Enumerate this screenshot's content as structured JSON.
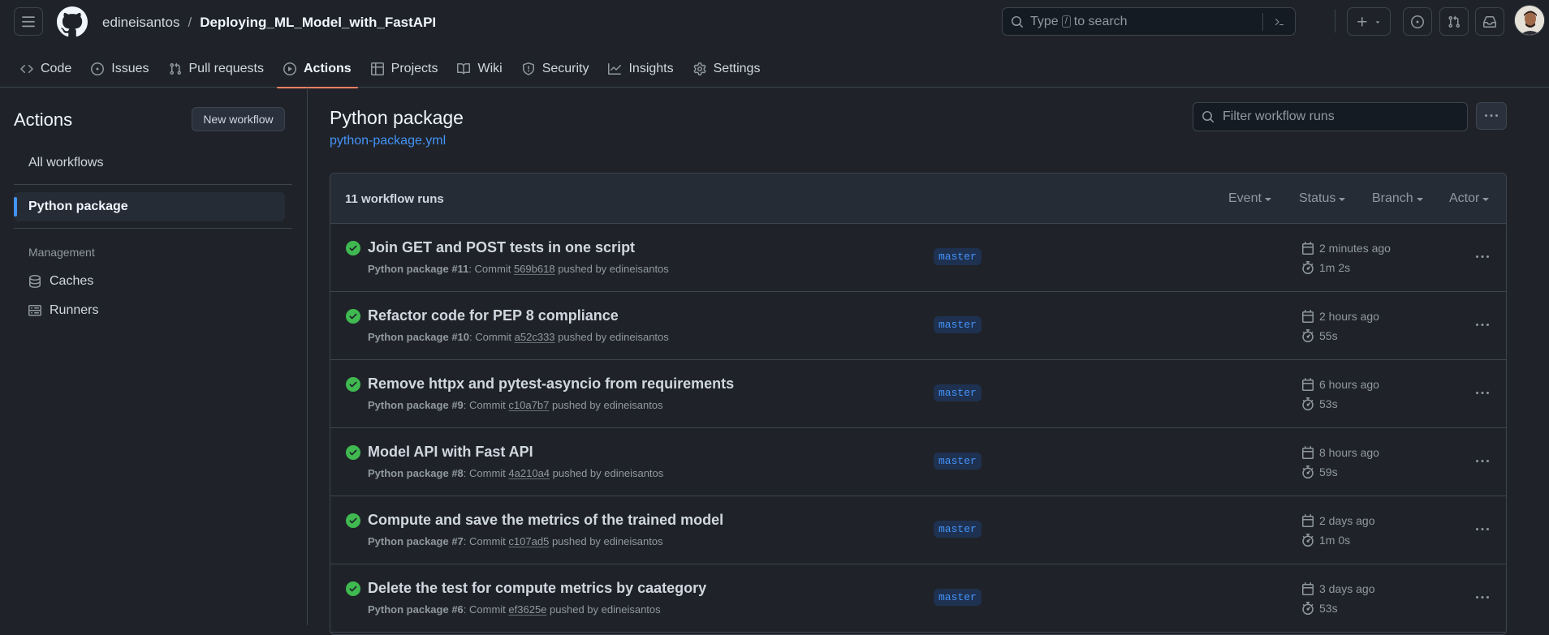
{
  "header": {
    "owner": "edineisantos",
    "separator": "/",
    "repo": "Deploying_ML_Model_with_FastAPI",
    "search_prefix": "Type",
    "search_key": "/",
    "search_suffix": "to search"
  },
  "tabs": [
    {
      "label": "Code",
      "icon": "code-icon"
    },
    {
      "label": "Issues",
      "icon": "issue-opened-icon"
    },
    {
      "label": "Pull requests",
      "icon": "git-pull-request-icon"
    },
    {
      "label": "Actions",
      "icon": "play-icon",
      "active": true
    },
    {
      "label": "Projects",
      "icon": "table-icon"
    },
    {
      "label": "Wiki",
      "icon": "book-icon"
    },
    {
      "label": "Security",
      "icon": "shield-icon"
    },
    {
      "label": "Insights",
      "icon": "graph-icon"
    },
    {
      "label": "Settings",
      "icon": "gear-icon"
    }
  ],
  "sidebar": {
    "title": "Actions",
    "new_workflow": "New workflow",
    "all_workflows": "All workflows",
    "selected_workflow": "Python package",
    "management_heading": "Management",
    "caches": "Caches",
    "runners": "Runners"
  },
  "main": {
    "title": "Python package",
    "workflow_file": "python-package.yml",
    "filter_placeholder": "Filter workflow runs",
    "runs_count": "11 workflow runs",
    "filters": [
      "Event",
      "Status",
      "Branch",
      "Actor"
    ]
  },
  "runs": [
    {
      "title": "Join GET and POST tests in one script",
      "workflow": "Python package",
      "number": "#11",
      "commit_label": ": Commit",
      "sha": "569b618",
      "pushed_by": "pushed by edineisantos",
      "branch": "master",
      "when": "2 minutes ago",
      "duration": "1m 2s",
      "status": "success"
    },
    {
      "title": "Refactor code for PEP 8 compliance",
      "workflow": "Python package",
      "number": "#10",
      "commit_label": ": Commit",
      "sha": "a52c333",
      "pushed_by": "pushed by edineisantos",
      "branch": "master",
      "when": "2 hours ago",
      "duration": "55s",
      "status": "success"
    },
    {
      "title": "Remove httpx and pytest-asyncio from requirements",
      "workflow": "Python package",
      "number": "#9",
      "commit_label": ": Commit",
      "sha": "c10a7b7",
      "pushed_by": "pushed by edineisantos",
      "branch": "master",
      "when": "6 hours ago",
      "duration": "53s",
      "status": "success"
    },
    {
      "title": "Model API with Fast API",
      "workflow": "Python package",
      "number": "#8",
      "commit_label": ": Commit",
      "sha": "4a210a4",
      "pushed_by": "pushed by edineisantos",
      "branch": "master",
      "when": "8 hours ago",
      "duration": "59s",
      "status": "success"
    },
    {
      "title": "Compute and save the metrics of the trained model",
      "workflow": "Python package",
      "number": "#7",
      "commit_label": ": Commit",
      "sha": "c107ad5",
      "pushed_by": "pushed by edineisantos",
      "branch": "master",
      "when": "2 days ago",
      "duration": "1m 0s",
      "status": "success"
    },
    {
      "title": "Delete the test for compute metrics by caategory",
      "workflow": "Python package",
      "number": "#6",
      "commit_label": ": Commit",
      "sha": "ef3625e",
      "pushed_by": "pushed by edineisantos",
      "branch": "master",
      "when": "3 days ago",
      "duration": "53s",
      "status": "success"
    }
  ],
  "colors": {
    "background": "#1f2329",
    "border": "#3d444d",
    "accent_blue": "#4493f8",
    "success_green": "#3fb950",
    "tab_underline": "#f78166"
  }
}
